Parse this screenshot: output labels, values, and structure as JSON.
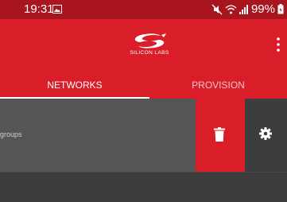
{
  "status_bar": {
    "time": "19:31",
    "battery": "99%",
    "icons": [
      "image-icon",
      "mute-icon",
      "wifi-icon",
      "signal-icon",
      "battery-icon"
    ]
  },
  "app_bar": {
    "logo_text": "SILICON LABS",
    "menu_icon": "more-vert-icon"
  },
  "tabs": [
    {
      "label": "NETWORKS",
      "selected": true
    },
    {
      "label": "PROVISION",
      "selected": false
    }
  ],
  "list": {
    "item_label": "groups",
    "actions": [
      "trash-icon",
      "gear-icon"
    ]
  },
  "colors": {
    "status_bar": "#a9151f",
    "brand_red": "#d91e2a",
    "row_bg": "#555555",
    "page_bg": "#3d3d3d"
  }
}
